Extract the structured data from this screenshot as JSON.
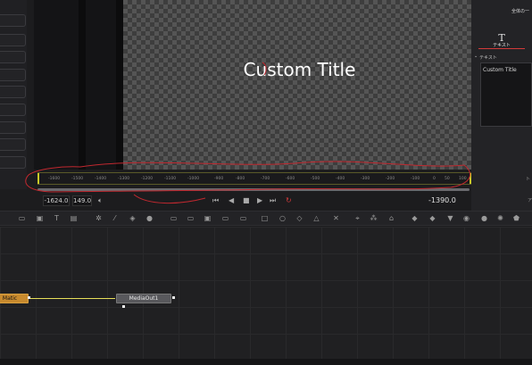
{
  "viewer": {
    "title_text": "Custom Title"
  },
  "ruler": {
    "ticks": [
      "-1600",
      "-1500",
      "-1400",
      "-1300",
      "-1200",
      "-1100",
      "-1000",
      "-900",
      "-800",
      "-700",
      "-600",
      "-500",
      "-400",
      "-300",
      "-200",
      "-100",
      "0",
      "50",
      "100"
    ]
  },
  "transport": {
    "field_left": "-1624.0",
    "field_right": "149.0",
    "current_frame": "-1390.0",
    "buttons": [
      "skip-back-icon",
      "step-back-icon",
      "stop-icon",
      "play-icon",
      "skip-forward-icon",
      "loop-icon"
    ],
    "loop_color": "#d23a3a"
  },
  "inspector": {
    "header": "全体の一",
    "tool_icon": "T",
    "tool_label": "テキスト",
    "section_title": "テキスト",
    "text_value": "Custom Title",
    "right_fragment_1": "ト",
    "right_fragment_2": "ア"
  },
  "nodes": {
    "mediaout": {
      "label": "MediaOut1"
    },
    "text": {
      "label": "Matic"
    },
    "link_color": "#e8e05a"
  },
  "annotation": {
    "color": "#c0282f"
  }
}
